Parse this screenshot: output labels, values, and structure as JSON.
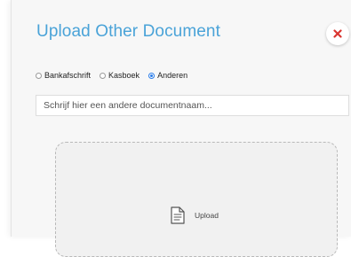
{
  "dialog": {
    "title": "Upload Other Document",
    "close_icon": "close-x-icon",
    "accent_color": "#4aa3d8",
    "close_color": "#d9342f"
  },
  "document_type": {
    "options": [
      {
        "label": "Bankafschrift",
        "selected": false
      },
      {
        "label": "Kasboek",
        "selected": false
      },
      {
        "label": "Anderen",
        "selected": true
      }
    ]
  },
  "document_name": {
    "value": "",
    "placeholder": "Schrijf hier een andere documentnaam..."
  },
  "dropzone": {
    "icon": "document-icon",
    "label": "Upload"
  }
}
